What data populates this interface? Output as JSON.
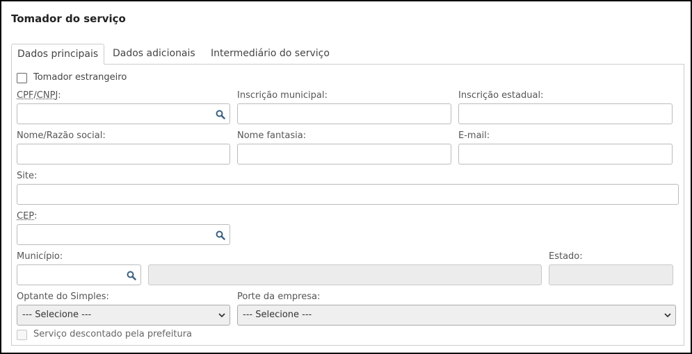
{
  "section_title": "Tomador do serviço",
  "tabs": [
    {
      "label": "Dados principais",
      "active": true
    },
    {
      "label": "Dados adicionais",
      "active": false
    },
    {
      "label": "Intermediário do serviço",
      "active": false
    }
  ],
  "form": {
    "foreign_checkbox_label": "Tomador estrangeiro",
    "cpf_cnpj": {
      "label_cpf": "CPF",
      "sep": "/",
      "label_cnpj": "CNPJ",
      "colon": ":",
      "value": ""
    },
    "inscricao_municipal": {
      "label": "Inscrição municipal:",
      "value": ""
    },
    "inscricao_estadual": {
      "label": "Inscrição estadual:",
      "value": ""
    },
    "nome_razao": {
      "label": "Nome/Razão social:",
      "value": ""
    },
    "nome_fantasia": {
      "label": "Nome fantasia:",
      "value": ""
    },
    "email": {
      "label": "E-mail:",
      "value": ""
    },
    "site": {
      "label": "Site:",
      "value": ""
    },
    "cep": {
      "label": "CEP",
      "colon": ":",
      "value": ""
    },
    "municipio": {
      "label": "Município:",
      "code_value": "",
      "name_value": ""
    },
    "estado": {
      "label": "Estado:",
      "value": ""
    },
    "optante_simples": {
      "label": "Optante do Simples:",
      "selected": "--- Selecione ---"
    },
    "porte_empresa": {
      "label": "Porte da empresa:",
      "selected": "--- Selecione ---"
    },
    "desconto_checkbox_label": "Serviço descontado pela prefeitura"
  },
  "icons": {
    "search": "search-icon",
    "dropdown": "chevron-down-icon"
  },
  "colors": {
    "border": "#bbbbbb",
    "disabled_bg": "#ececec",
    "text": "#444444"
  }
}
